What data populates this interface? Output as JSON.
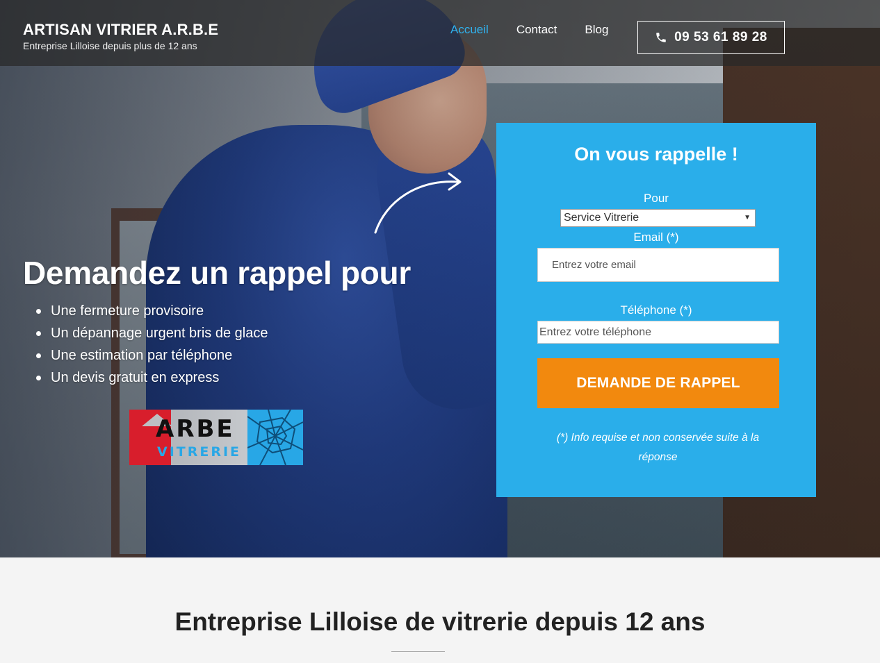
{
  "header": {
    "brand_title": "ARTISAN VITRIER A.R.B.E",
    "brand_subtitle": "Entreprise Lilloise depuis plus de 12 ans",
    "nav": [
      {
        "label": "Accueil",
        "active": true
      },
      {
        "label": "Contact",
        "active": false
      },
      {
        "label": "Blog",
        "active": false
      }
    ],
    "phone": "09 53 61 89 28",
    "phone_icon": "phone-icon"
  },
  "hero": {
    "headline": "Demandez un rappel pour",
    "bullets": [
      "Une fermeture provisoire",
      "Un dépannage urgent bris de glace",
      "Une estimation par téléphone",
      "Un devis gratuit en express"
    ],
    "logo": {
      "line1": "ARBE",
      "line2": "VITRERIE"
    }
  },
  "form": {
    "title": "On vous rappelle !",
    "pour_label": "Pour",
    "select_value": "Service Vitrerie",
    "email_label": "Email (*)",
    "email_placeholder": "Entrez votre email",
    "tel_label": "Téléphone (*)",
    "tel_placeholder": "Entrez votre téléphone",
    "submit_label": "DEMANDE DE RAPPEL",
    "note": "(*) Info requise et non conservée suite à la réponse"
  },
  "section": {
    "title": "Entreprise Lilloise de vitrerie depuis 12 ans"
  },
  "colors": {
    "accent_blue": "#2aaeea",
    "nav_active": "#30b2ee",
    "cta_orange": "#f2890e"
  }
}
